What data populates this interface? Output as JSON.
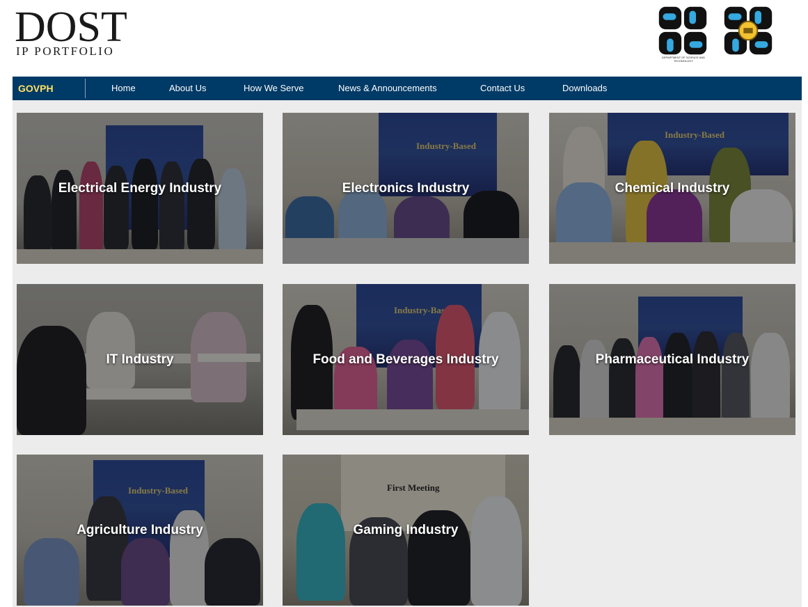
{
  "header": {
    "logo_title": "DOST",
    "logo_subtitle": "IP PORTFOLIO",
    "seal_left_icon": "dost-seal-icon",
    "seal_right_icon": "dost-region-seal-icon",
    "seal_caption": "DEPARTMENT OF SCIENCE AND TECHNOLOGY"
  },
  "nav": {
    "govph": "GOVPH",
    "items": [
      {
        "label": "Home"
      },
      {
        "label": "About Us"
      },
      {
        "label": "How We Serve"
      },
      {
        "label": "News & Announcements"
      },
      {
        "label": "Contact Us"
      },
      {
        "label": "Downloads"
      }
    ],
    "bg_color": "#003a66",
    "govph_color": "#ffe066"
  },
  "tiles": [
    {
      "label": "Electrical Energy Industry"
    },
    {
      "label": "Electronics Industry"
    },
    {
      "label": "Chemical Industry"
    },
    {
      "label": "IT Industry"
    },
    {
      "label": "Food and Beverages Industry"
    },
    {
      "label": "Pharmaceutical Industry"
    },
    {
      "label": "Agriculture Industry"
    },
    {
      "label": "Gaming Industry"
    }
  ],
  "photo_banner": {
    "line1": "Industry-Based",
    "line2": "First Meeting"
  },
  "colors": {
    "page_bg": "#ececec",
    "tile_text": "#ffffff"
  }
}
